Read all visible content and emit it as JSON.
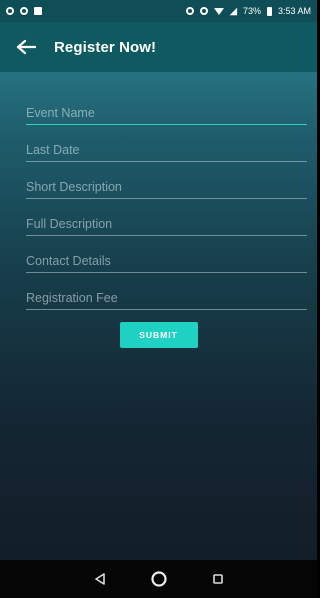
{
  "status_bar": {
    "battery": "73%",
    "time": "3:53 AM",
    "icons": [
      "circle-icon",
      "alarm-icon",
      "image-icon",
      "sync-icon",
      "alarm-icon",
      "wifi-icon",
      "signal-icon",
      "battery-icon"
    ]
  },
  "toolbar": {
    "title": "Register Now!",
    "back_icon": "arrow-left-icon"
  },
  "form": {
    "fields": [
      {
        "placeholder": "Event Name",
        "value": ""
      },
      {
        "placeholder": "Last Date",
        "value": ""
      },
      {
        "placeholder": "Short Description",
        "value": ""
      },
      {
        "placeholder": "Full Description",
        "value": ""
      },
      {
        "placeholder": "Contact Details",
        "value": ""
      },
      {
        "placeholder": "Registration Fee",
        "value": ""
      }
    ],
    "submit_label": "SUBMIT"
  },
  "nav_bar": {
    "icons": [
      "back-triangle-icon",
      "home-circle-icon",
      "recents-square-icon"
    ]
  },
  "colors": {
    "toolbar": "#0f5a61",
    "accent": "#1fd1c3"
  }
}
